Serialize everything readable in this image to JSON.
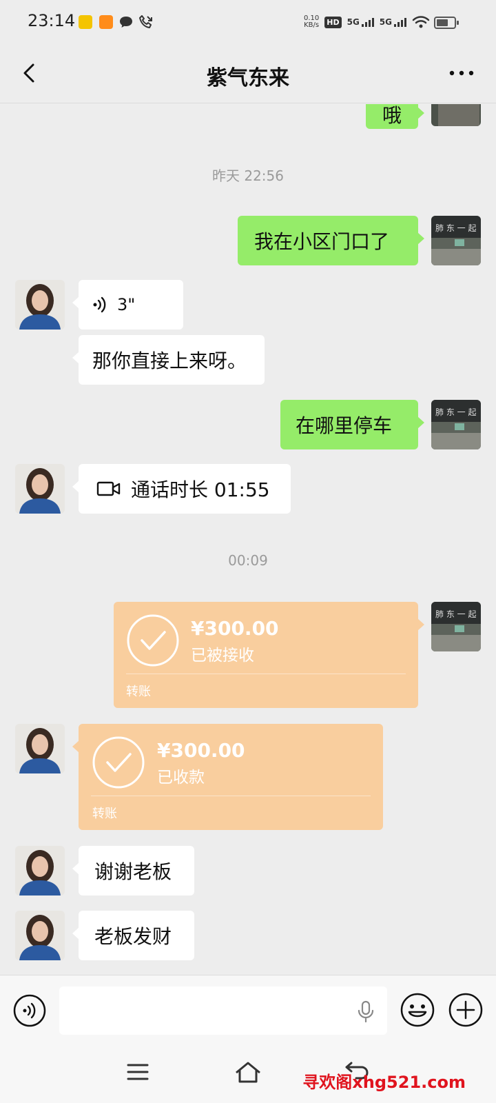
{
  "status_bar": {
    "time": "23:14",
    "net_speed_value": "0.10",
    "net_speed_unit": "KB/s",
    "hd_label": "HD",
    "sim1_label": "5G",
    "sim2_label": "5G"
  },
  "header": {
    "title": "紫气东来"
  },
  "messages": [
    {
      "type": "text",
      "side": "right",
      "text": "哦"
    },
    {
      "type": "timestamp",
      "text": "昨天 22:56"
    },
    {
      "type": "text",
      "side": "right",
      "text": "我在小区门口了"
    },
    {
      "type": "voice",
      "side": "left",
      "duration": "3\""
    },
    {
      "type": "text",
      "side": "left",
      "text": "那你直接上来呀。"
    },
    {
      "type": "text",
      "side": "right",
      "text": "在哪里停车"
    },
    {
      "type": "call",
      "side": "left",
      "text": "通话时长 01:55"
    },
    {
      "type": "timestamp",
      "text": "00:09"
    },
    {
      "type": "transfer",
      "side": "right",
      "amount": "¥300.00",
      "status": "已被接收",
      "label": "转账"
    },
    {
      "type": "transfer",
      "side": "left",
      "amount": "¥300.00",
      "status": "已收款",
      "label": "转账"
    },
    {
      "type": "text",
      "side": "left",
      "text": "谢谢老板"
    },
    {
      "type": "text",
      "side": "left",
      "text": "老板发财"
    }
  ],
  "icons": {
    "back": "back-arrow-icon",
    "more": "more-dots-icon",
    "voice_toggle": "voice-icon",
    "mic": "mic-icon",
    "emoji": "emoji-icon",
    "plus": "plus-icon",
    "video_call": "video-call-icon"
  },
  "colors": {
    "background": "#ededed",
    "sent_bubble": "#95ec69",
    "received_bubble": "#ffffff",
    "transfer_card": "#f9ce9e"
  },
  "watermark": "寻欢阁xhg521.com"
}
